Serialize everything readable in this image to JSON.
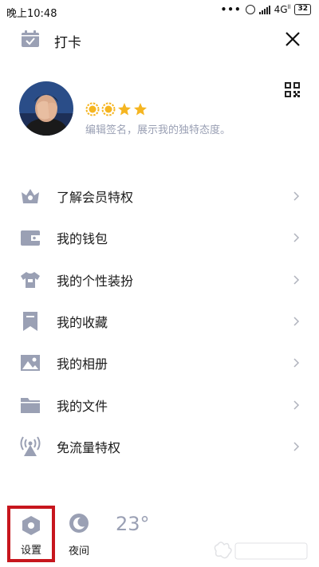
{
  "status_bar": {
    "time": "晚上10:48",
    "dots": "•••",
    "network": "4G",
    "network_sup": "ll",
    "battery": "32"
  },
  "header": {
    "checkin_label": "打卡"
  },
  "profile": {
    "signature": "编辑签名，展示我的独特态度。",
    "star_count": 4
  },
  "menu": {
    "items": [
      {
        "label": "了解会员特权",
        "icon": "vip-crown-icon"
      },
      {
        "label": "我的钱包",
        "icon": "wallet-icon"
      },
      {
        "label": "我的个性装扮",
        "icon": "shirt-icon"
      },
      {
        "label": "我的收藏",
        "icon": "bookmark-icon"
      },
      {
        "label": "我的相册",
        "icon": "photo-icon"
      },
      {
        "label": "我的文件",
        "icon": "folder-icon"
      },
      {
        "label": "免流量特权",
        "icon": "signal-tower-icon"
      }
    ]
  },
  "bottom_bar": {
    "settings_label": "设置",
    "night_label": "夜间",
    "temperature": "23°"
  },
  "colors": {
    "icon_gray": "#9aa0b4",
    "highlight_red": "#c7161d",
    "star_gold": "#f5b521"
  }
}
